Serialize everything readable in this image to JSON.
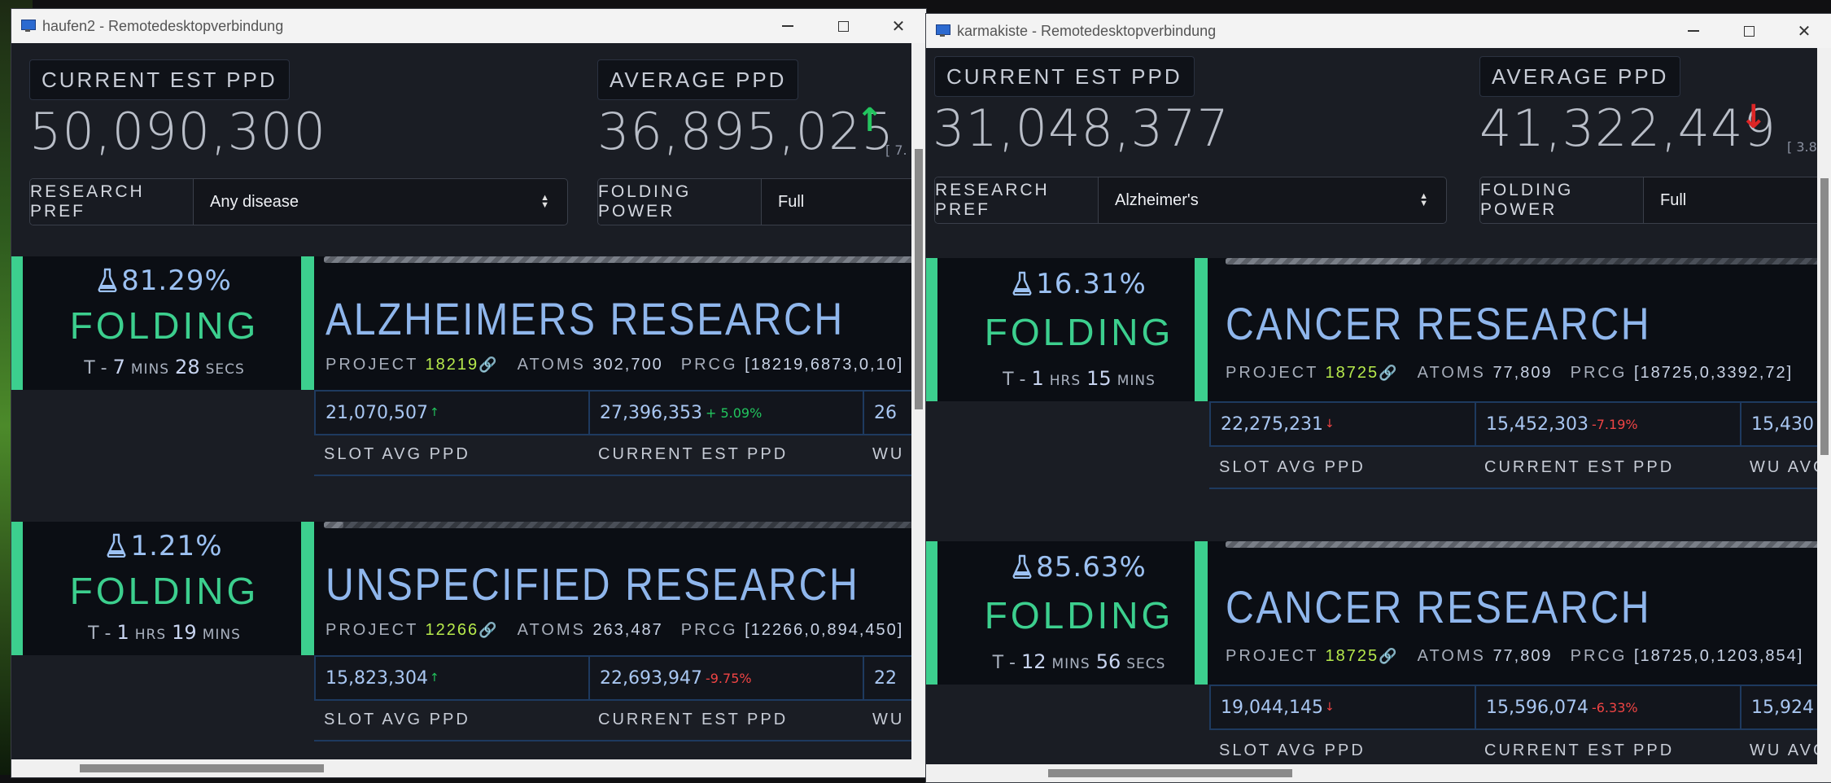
{
  "windows": [
    {
      "title": "haufen2 - Remotedesktopverbindung",
      "stats": {
        "current_label": "CURRENT EST PPD",
        "current_value": "50,090,300",
        "average_label": "AVERAGE PPD",
        "average_value": "36,895,025",
        "average_trend": "up",
        "average_bracket": "[ 7."
      },
      "research_pref": {
        "label": "RESEARCH PREF",
        "value": "Any disease"
      },
      "folding_power": {
        "label": "FOLDING POWER",
        "value": "Full"
      },
      "slots": [
        {
          "percent": "81.29%",
          "status": "FOLDING",
          "eta": {
            "a_num": "7",
            "a_unit": "MINS",
            "b_num": "28",
            "b_unit": "SECS"
          },
          "progress": 0.98,
          "title": "ALZHEIMERS RESEARCH",
          "project": "18219",
          "atoms": "302,700",
          "prcg": "[18219,6873,0,10]",
          "slot_avg": "21,070,507",
          "slot_trend": "up",
          "current_est": "27,396,353",
          "current_delta": "+ 5.09%",
          "current_delta_sign": "pos",
          "wu_avg": "26"
        },
        {
          "percent": "1.21%",
          "status": "FOLDING",
          "eta": {
            "a_num": "1",
            "a_unit": "HRS",
            "b_num": "19",
            "b_unit": "MINS"
          },
          "progress": 0.03,
          "title": "UNSPECIFIED RESEARCH",
          "project": "12266",
          "atoms": "263,487",
          "prcg": "[12266,0,894,450]",
          "slot_avg": "15,823,304",
          "slot_trend": "up",
          "current_est": "22,693,947",
          "current_delta": "-9.75%",
          "current_delta_sign": "neg",
          "wu_avg": "22"
        }
      ],
      "labels": {
        "project": "PROJECT",
        "atoms": "ATOMS",
        "prcg": "PRCG",
        "slot_avg": "SLOT AVG PPD",
        "current_est": "CURRENT EST PPD",
        "wu_avg": "WU"
      }
    },
    {
      "title": "karmakiste - Remotedesktopverbindung",
      "stats": {
        "current_label": "CURRENT EST PPD",
        "current_value": "31,048,377",
        "average_label": "AVERAGE PPD",
        "average_value": "41,322,449",
        "average_trend": "down",
        "average_bracket": "[ 3.8"
      },
      "research_pref": {
        "label": "RESEARCH PREF",
        "value": "Alzheimer's"
      },
      "folding_power": {
        "label": "FOLDING POWER",
        "value": "Full"
      },
      "slots": [
        {
          "percent": "16.31%",
          "status": "FOLDING",
          "eta": {
            "a_num": "1",
            "a_unit": "HRS",
            "b_num": "15",
            "b_unit": "MINS"
          },
          "progress": 0.3,
          "title": "CANCER RESEARCH",
          "project": "18725",
          "atoms": "77,809",
          "prcg": "[18725,0,3392,72]",
          "slot_avg": "22,275,231",
          "slot_trend": "down",
          "current_est": "15,452,303",
          "current_delta": "-7.19%",
          "current_delta_sign": "neg",
          "wu_avg": "15,430"
        },
        {
          "percent": "85.63%",
          "status": "FOLDING",
          "eta": {
            "a_num": "12",
            "a_unit": "MINS",
            "b_num": "56",
            "b_unit": "SECS"
          },
          "progress": 0.99,
          "title": "CANCER RESEARCH",
          "project": "18725",
          "atoms": "77,809",
          "prcg": "[18725,0,1203,854]",
          "slot_avg": "19,044,145",
          "slot_trend": "down",
          "current_est": "15,596,074",
          "current_delta": "-6.33%",
          "current_delta_sign": "neg",
          "wu_avg": "15,924"
        }
      ],
      "labels": {
        "project": "PROJECT",
        "atoms": "ATOMS",
        "prcg": "PRCG",
        "slot_avg": "SLOT AVG PPD",
        "current_est": "CURRENT EST PPD",
        "wu_avg": "WU AVG"
      }
    }
  ],
  "eta_prefix": "T -",
  "colors": {
    "accent_green": "#3ccf8e",
    "title_blue": "#8fb6ec",
    "project_green": "#b7ea4c",
    "up": "#22c55e",
    "down": "#dc2626"
  }
}
